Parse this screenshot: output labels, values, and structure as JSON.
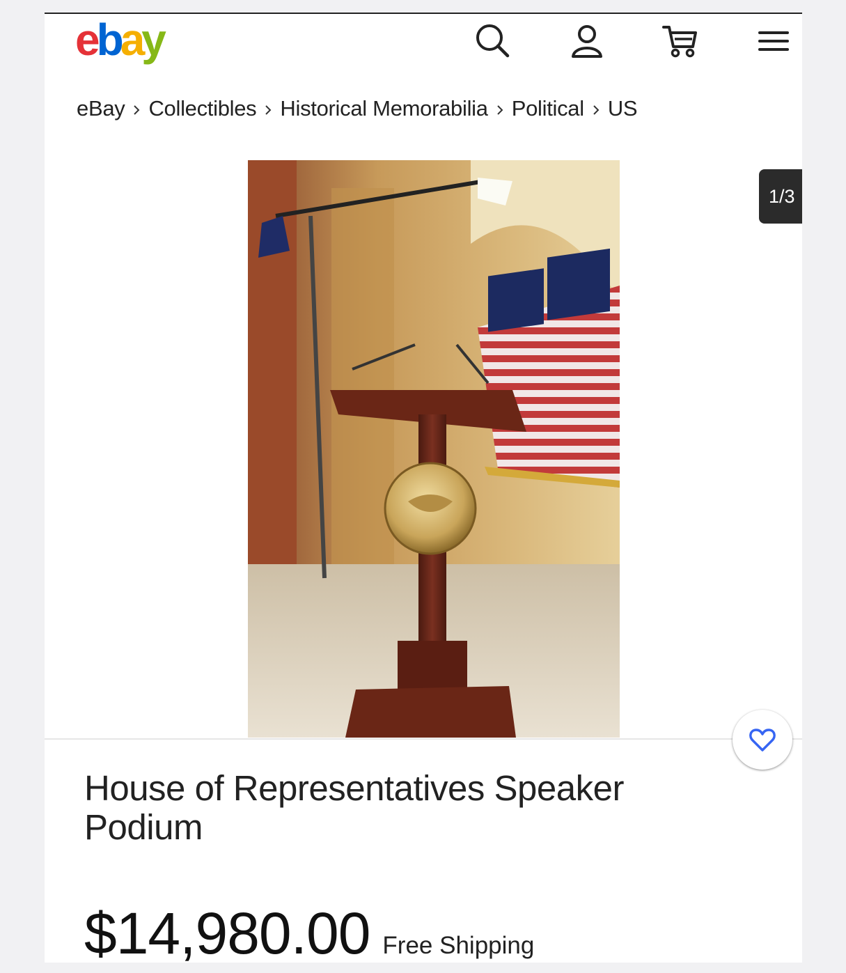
{
  "header": {
    "logo_letters": [
      "e",
      "b",
      "a",
      "y"
    ],
    "logo_colors": [
      "#e53238",
      "#0064d2",
      "#f5af02",
      "#86b817"
    ],
    "icons": [
      "search-icon",
      "account-icon",
      "cart-icon",
      "menu-icon"
    ]
  },
  "breadcrumb": [
    "eBay",
    "Collectibles",
    "Historical Memorabilia",
    "Political",
    "US"
  ],
  "gallery": {
    "counter": "1/3",
    "image_alt": "Wooden speaker podium with gold seal in front of American flags in a Capitol hallway"
  },
  "listing": {
    "title": "House of Representatives Speaker Podium",
    "price": "$14,980.00",
    "shipping": "Free Shipping"
  },
  "colors": {
    "text": "#222222",
    "counter_bg": "#2b2b2b",
    "watch_icon": "#3665f3"
  }
}
